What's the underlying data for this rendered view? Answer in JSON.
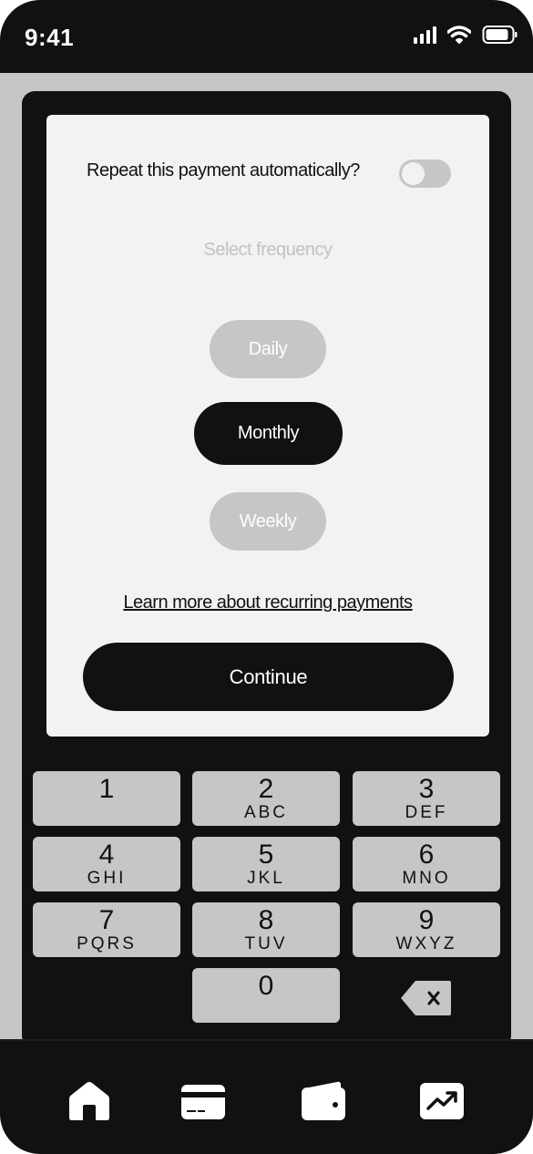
{
  "status_bar": {
    "time": "9:41",
    "icons": [
      "signal-icon",
      "wifi-icon",
      "battery-icon"
    ]
  },
  "recurring": {
    "repeat_label": "Repeat this payment automatically?",
    "toggle_on": false,
    "select_label": "Select frequency",
    "options": [
      {
        "label": "Daily",
        "selected": false
      },
      {
        "label": "Monthly",
        "selected": true
      },
      {
        "label": "Weekly",
        "selected": false
      }
    ],
    "learn_more": "Learn more about recurring payments",
    "continue_label": "Continue"
  },
  "keypad": {
    "keys": [
      {
        "digit": "1",
        "letters": ""
      },
      {
        "digit": "2",
        "letters": "ABC"
      },
      {
        "digit": "3",
        "letters": "DEF"
      },
      {
        "digit": "4",
        "letters": "GHI"
      },
      {
        "digit": "5",
        "letters": "JKL"
      },
      {
        "digit": "6",
        "letters": "MNO"
      },
      {
        "digit": "7",
        "letters": "PQRS"
      },
      {
        "digit": "8",
        "letters": "TUV"
      },
      {
        "digit": "9",
        "letters": "WXYZ"
      },
      {
        "digit": "0",
        "letters": ""
      }
    ],
    "backspace_icon": "backspace-icon"
  },
  "bottom_nav": {
    "items": [
      "home-icon",
      "card-icon",
      "wallet-icon",
      "chart-trend-icon"
    ]
  },
  "colors": {
    "dark": "#111111",
    "light_gray": "#c6c6c6",
    "card_bg": "#f2f2f2",
    "muted_text": "#c2c2c2"
  }
}
